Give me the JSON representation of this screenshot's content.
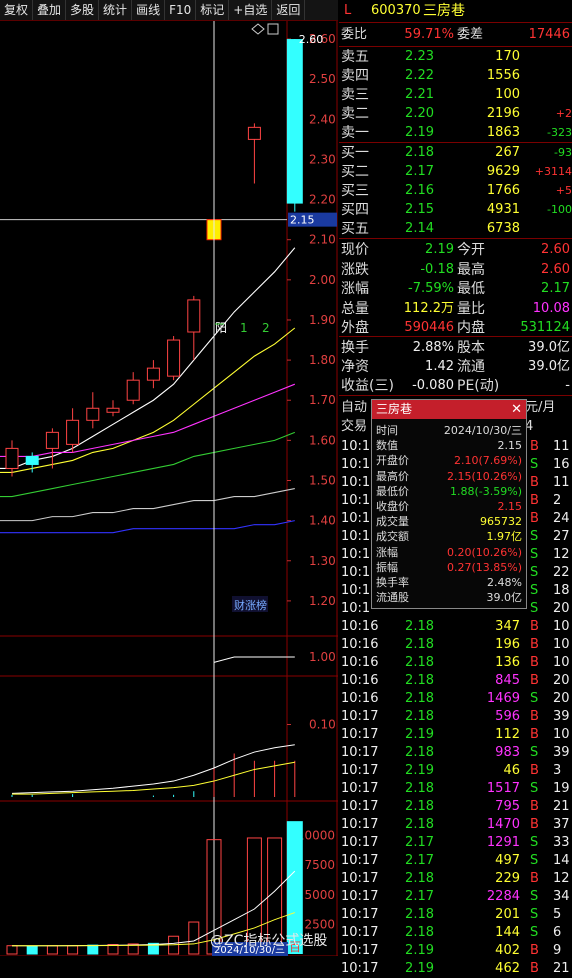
{
  "toolbar": {
    "buttons": [
      "复权",
      "叠加",
      "多股",
      "统计",
      "画线",
      "F10",
      "标记",
      "+自选",
      "返回"
    ]
  },
  "stock": {
    "code": "600370",
    "name": "三房巷",
    "prefix": "L"
  },
  "weibi": {
    "label": "委比",
    "value": "59.71%",
    "label2": "委差",
    "value2": "17446"
  },
  "asks": [
    {
      "label": "卖五",
      "price": "2.23",
      "vol": "170",
      "chg": ""
    },
    {
      "label": "卖四",
      "price": "2.22",
      "vol": "1556",
      "chg": ""
    },
    {
      "label": "卖三",
      "price": "2.21",
      "vol": "100",
      "chg": ""
    },
    {
      "label": "卖二",
      "price": "2.20",
      "vol": "2196",
      "chg": "+2"
    },
    {
      "label": "卖一",
      "price": "2.19",
      "vol": "1863",
      "chg": "-323"
    }
  ],
  "bids": [
    {
      "label": "买一",
      "price": "2.18",
      "vol": "267",
      "chg": "-93"
    },
    {
      "label": "买二",
      "price": "2.17",
      "vol": "9629",
      "chg": "+3114"
    },
    {
      "label": "买三",
      "price": "2.16",
      "vol": "1766",
      "chg": "+5"
    },
    {
      "label": "买四",
      "price": "2.15",
      "vol": "4931",
      "chg": "-100"
    },
    {
      "label": "买五",
      "price": "2.14",
      "vol": "6738",
      "chg": ""
    }
  ],
  "quote": [
    {
      "l1": "现价",
      "v1": "2.19",
      "l2": "今开",
      "v2": "2.60"
    },
    {
      "l1": "涨跌",
      "v1": "-0.18",
      "l2": "最高",
      "v2": "2.60"
    },
    {
      "l1": "涨幅",
      "v1": "-7.59%",
      "l2": "最低",
      "v2": "2.17"
    },
    {
      "l1": "总量",
      "v1": "112.2万",
      "l2": "量比",
      "v2": "10.08"
    },
    {
      "l1": "外盘",
      "v1": "590446",
      "l2": "内盘",
      "v2": "531124"
    }
  ],
  "finance": [
    {
      "l1": "换手",
      "v1": "2.88%",
      "l2": "股本",
      "v2": "39.0亿"
    },
    {
      "l1": "净资",
      "v1": "1.42",
      "l2": "流通",
      "v2": "39.0亿"
    },
    {
      "l1": "收益(三)",
      "v1": "-0.080",
      "l2": "PE(动)",
      "v2": "-"
    }
  ],
  "partial": {
    "zidong": "自动",
    "jiaoyi": "交易",
    "yuanyue": "元/月",
    "four": "4"
  },
  "ticks": [
    {
      "time": "10:1",
      "price": "",
      "vol": "",
      "side": "B",
      "n": "11"
    },
    {
      "time": "10:1",
      "price": "",
      "vol": "",
      "side": "S",
      "n": "16"
    },
    {
      "time": "10:1",
      "price": "",
      "vol": "",
      "side": "B",
      "n": "11"
    },
    {
      "time": "10:1",
      "price": "",
      "vol": "",
      "side": "B",
      "n": "2"
    },
    {
      "time": "10:1",
      "price": "",
      "vol": "",
      "side": "B",
      "n": "24"
    },
    {
      "time": "10:1",
      "price": "",
      "vol": "",
      "side": "S",
      "n": "27"
    },
    {
      "time": "10:1",
      "price": "",
      "vol": "",
      "side": "S",
      "n": "12"
    },
    {
      "time": "10:1",
      "price": "",
      "vol": "",
      "side": "S",
      "n": "22"
    },
    {
      "time": "10:1",
      "price": "",
      "vol": "",
      "side": "S",
      "n": "18"
    },
    {
      "time": "10:1",
      "price": "",
      "vol": "",
      "side": "S",
      "n": "20"
    },
    {
      "time": "10:16",
      "price": "2.18",
      "vol": "347",
      "side": "B",
      "n": "10"
    },
    {
      "time": "10:16",
      "price": "2.18",
      "vol": "196",
      "side": "B",
      "n": "10"
    },
    {
      "time": "10:16",
      "price": "2.18",
      "vol": "136",
      "side": "B",
      "n": "10"
    },
    {
      "time": "10:16",
      "price": "2.18",
      "vol": "845",
      "side": "B",
      "n": "20"
    },
    {
      "time": "10:16",
      "price": "2.18",
      "vol": "1469",
      "side": "S",
      "n": "20"
    },
    {
      "time": "10:17",
      "price": "2.18",
      "vol": "596",
      "side": "B",
      "n": "39"
    },
    {
      "time": "10:17",
      "price": "2.19",
      "vol": "112",
      "side": "B",
      "n": "10"
    },
    {
      "time": "10:17",
      "price": "2.18",
      "vol": "983",
      "side": "S",
      "n": "39"
    },
    {
      "time": "10:17",
      "price": "2.19",
      "vol": "46",
      "side": "B",
      "n": "3"
    },
    {
      "time": "10:17",
      "price": "2.18",
      "vol": "1517",
      "side": "S",
      "n": "19"
    },
    {
      "time": "10:17",
      "price": "2.18",
      "vol": "795",
      "side": "B",
      "n": "21"
    },
    {
      "time": "10:17",
      "price": "2.18",
      "vol": "1470",
      "side": "B",
      "n": "37"
    },
    {
      "time": "10:17",
      "price": "2.17",
      "vol": "1291",
      "side": "S",
      "n": "33"
    },
    {
      "time": "10:17",
      "price": "2.17",
      "vol": "497",
      "side": "S",
      "n": "14"
    },
    {
      "time": "10:17",
      "price": "2.18",
      "vol": "229",
      "side": "B",
      "n": "12"
    },
    {
      "time": "10:17",
      "price": "2.17",
      "vol": "2284",
      "side": "S",
      "n": "34"
    },
    {
      "time": "10:17",
      "price": "2.18",
      "vol": "201",
      "side": "S",
      "n": "5"
    },
    {
      "time": "10:17",
      "price": "2.18",
      "vol": "144",
      "side": "S",
      "n": "6"
    },
    {
      "time": "10:17",
      "price": "2.19",
      "vol": "402",
      "side": "B",
      "n": "9"
    },
    {
      "time": "10:17",
      "price": "2.19",
      "vol": "462",
      "side": "B",
      "n": "21"
    }
  ],
  "tooltip": {
    "title": "三房巷",
    "rows": [
      {
        "k": "时间",
        "v": "2024/10/30/三"
      },
      {
        "k": "数值",
        "v": "2.15"
      },
      {
        "k": "开盘价",
        "v": "2.10(7.69%)"
      },
      {
        "k": "最高价",
        "v": "2.15(10.26%)"
      },
      {
        "k": "最低价",
        "v": "1.88(-3.59%)"
      },
      {
        "k": "收盘价",
        "v": "2.15"
      },
      {
        "k": "成交量",
        "v": "965732"
      },
      {
        "k": "成交额",
        "v": "1.97亿"
      },
      {
        "k": "涨幅",
        "v": "0.20(10.26%)"
      },
      {
        "k": "振幅",
        "v": "0.27(13.85%)"
      },
      {
        "k": "换手率",
        "v": "2.48%"
      },
      {
        "k": "流通股",
        "v": "39.0亿"
      }
    ]
  },
  "chart_labels": {
    "high_label": "2.60",
    "cursor_price": "2.15",
    "yang": "阳",
    "ma_legend_1": "1",
    "ma_legend_2": "2",
    "news_tag": "财涨榜",
    "cursor_date": "2024/10/30/三",
    "vol_axis_tag": "百",
    "vol_axis_tag2": "百"
  },
  "watermark": "@ZC指标公式选股",
  "chart_data": [
    {
      "type": "candlestick",
      "ylim": [
        1.12,
        2.64
      ],
      "price_ticks": [
        2.6,
        2.5,
        2.4,
        2.3,
        2.2,
        2.1,
        2.0,
        1.9,
        1.8,
        1.7,
        1.6,
        1.5,
        1.4,
        1.3,
        1.2
      ],
      "candles": [
        {
          "o": 1.53,
          "c": 1.58,
          "h": 1.6,
          "l": 1.51
        },
        {
          "o": 1.56,
          "c": 1.54,
          "h": 1.57,
          "l": 1.52
        },
        {
          "o": 1.58,
          "c": 1.62,
          "h": 1.63,
          "l": 1.53
        },
        {
          "o": 1.59,
          "c": 1.65,
          "h": 1.68,
          "l": 1.57
        },
        {
          "o": 1.65,
          "c": 1.68,
          "h": 1.72,
          "l": 1.63
        },
        {
          "o": 1.67,
          "c": 1.68,
          "h": 1.7,
          "l": 1.66
        },
        {
          "o": 1.7,
          "c": 1.75,
          "h": 1.77,
          "l": 1.69
        },
        {
          "o": 1.75,
          "c": 1.78,
          "h": 1.8,
          "l": 1.73
        },
        {
          "o": 1.76,
          "c": 1.85,
          "h": 1.86,
          "l": 1.75
        },
        {
          "o": 1.87,
          "c": 1.95,
          "h": 1.96,
          "l": 1.8
        },
        {
          "o": 2.1,
          "c": 2.15,
          "h": 2.15,
          "l": 1.88
        },
        null,
        {
          "o": 2.35,
          "c": 2.38,
          "h": 2.39,
          "l": 2.24
        },
        null,
        {
          "o": 2.6,
          "c": 2.19,
          "h": 2.6,
          "l": 2.17
        }
      ],
      "ma_lines": [
        {
          "name": "",
          "color": "#ffffff",
          "values": [
            1.53,
            1.55,
            1.56,
            1.58,
            1.61,
            1.64,
            1.67,
            1.7,
            1.74,
            1.8,
            1.86,
            1.92,
            1.97,
            2.02,
            2.08
          ]
        },
        {
          "name": "",
          "color": "#ffff33",
          "values": [
            1.52,
            1.53,
            1.54,
            1.55,
            1.57,
            1.58,
            1.6,
            1.62,
            1.65,
            1.69,
            1.73,
            1.77,
            1.81,
            1.84,
            1.88
          ]
        },
        {
          "name": "",
          "color": "#ff33ff",
          "values": [
            1.56,
            1.56,
            1.57,
            1.57,
            1.58,
            1.59,
            1.6,
            1.61,
            1.62,
            1.64,
            1.66,
            1.68,
            1.7,
            1.72,
            1.74
          ]
        },
        {
          "name": "",
          "color": "#33cc33",
          "values": [
            1.46,
            1.47,
            1.48,
            1.49,
            1.5,
            1.51,
            1.52,
            1.53,
            1.54,
            1.56,
            1.57,
            1.58,
            1.59,
            1.6,
            1.62
          ]
        },
        {
          "name": "",
          "color": "#cccccc",
          "values": [
            1.4,
            1.4,
            1.41,
            1.41,
            1.42,
            1.42,
            1.43,
            1.43,
            1.44,
            1.45,
            1.45,
            1.46,
            1.46,
            1.47,
            1.48
          ]
        },
        {
          "name": "",
          "color": "#3333ff",
          "values": [
            1.37,
            1.37,
            1.37,
            1.37,
            1.37,
            1.37,
            1.38,
            1.38,
            1.38,
            1.38,
            1.38,
            1.38,
            1.39,
            1.39,
            1.4
          ]
        }
      ]
    },
    {
      "type": "line",
      "ylim": [
        0.7,
        1.3
      ],
      "ticks": [
        1.0
      ],
      "values": [
        null,
        null,
        null,
        null,
        null,
        null,
        null,
        null,
        null,
        null,
        0.9,
        1.0,
        1.0,
        1.0,
        1.0
      ]
    },
    {
      "type": "bar",
      "ylim": [
        0,
        0.16
      ],
      "ticks": [
        0.1
      ],
      "values": [
        0.003,
        0.003,
        0,
        0.004,
        0,
        0,
        0,
        0.002,
        0.003,
        0.008,
        0.04,
        0.06,
        0.05,
        0.05,
        0.05
      ],
      "line_values": [
        0.005,
        0.006,
        0.007,
        0.008,
        0.01,
        0.012,
        0.015,
        0.018,
        0.022,
        0.03,
        0.04,
        0.052,
        0.062,
        0.068,
        0.072
      ],
      "line2_values": [
        0.004,
        0.004,
        0.005,
        0.006,
        0.007,
        0.008,
        0.009,
        0.011,
        0.013,
        0.016,
        0.022,
        0.03,
        0.038,
        0.043,
        0.048
      ]
    },
    {
      "type": "bar",
      "ylim": [
        0,
        12500
      ],
      "ticks": [
        10000,
        7500,
        5000,
        2500
      ],
      "values": [
        700,
        650,
        700,
        700,
        750,
        800,
        850,
        900,
        1500,
        2700,
        9657,
        null,
        9800,
        9800,
        11220
      ],
      "line_values": [
        700,
        700,
        700,
        710,
        720,
        740,
        760,
        800,
        900,
        1100,
        2000,
        2900,
        3800,
        5300,
        7000
      ],
      "line2_values": [
        700,
        700,
        700,
        700,
        710,
        720,
        730,
        750,
        780,
        850,
        1200,
        1700,
        2200,
        2900,
        3500
      ]
    }
  ]
}
